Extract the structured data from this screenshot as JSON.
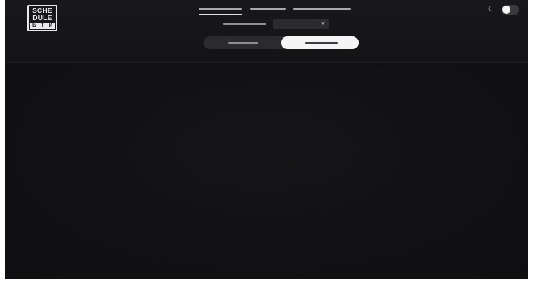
{
  "logo": {
    "line1": "SCHE",
    "line2": "DULE",
    "foot": [
      "Б",
      "Т",
      "И"
    ]
  },
  "nav": {
    "items": [
      {
        "label": "",
        "active": true
      },
      {
        "label": "",
        "active": false
      },
      {
        "label": "",
        "active": false
      }
    ]
  },
  "theme": {
    "icon": "moon-icon",
    "dark_mode": true
  },
  "filter": {
    "label": "",
    "selected": ""
  },
  "view_switch": {
    "options": [
      {
        "label": "",
        "selected": false
      },
      {
        "label": "",
        "selected": true
      }
    ]
  },
  "colors": {
    "background": "#101012",
    "header": "#18181b",
    "accent": "#f4f4f5"
  }
}
